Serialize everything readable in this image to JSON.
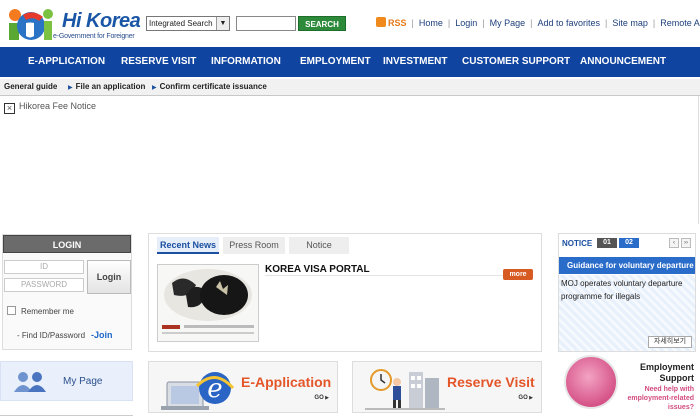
{
  "header": {
    "logo_word": "Hi Korea",
    "logo_sub": "e-Government for Foreigner",
    "search_select": "Integrated Search",
    "search_button": "SEARCH",
    "util_links": [
      "RSS",
      "Home",
      "Login",
      "My Page",
      "Add to favorites",
      "Site map",
      "Remote Assistant"
    ]
  },
  "nav": {
    "tabs": [
      "E-APPLICATION",
      "RESERVE VISIT",
      "INFORMATION",
      "EMPLOYMENT",
      "INVESTMENT",
      "CUSTOMER SUPPORT",
      "ANNOUNCEMENT"
    ]
  },
  "subnav": {
    "items": [
      "General guide",
      "File an application",
      "Confirm certificate issuance"
    ]
  },
  "fee_notice": {
    "close_glyph": "×",
    "label": "Hikorea Fee Notice"
  },
  "login": {
    "title": "LOGIN",
    "id_placeholder": "ID",
    "password_placeholder": "PASSWORD",
    "button": "Login",
    "remember": "Remember me",
    "find": "- Find ID/Password",
    "join": "-Join"
  },
  "news": {
    "tabs": [
      "Recent News",
      "Press Room",
      "Notice"
    ],
    "title": "KOREA VISA PORTAL",
    "more": "more"
  },
  "notice": {
    "label": "NOTICE",
    "pages": [
      "01",
      "02"
    ],
    "prev": "‹",
    "next": "››",
    "headline": "Guidance for voluntary departure of",
    "text": "MOJ operates voluntary departure programme for illegals",
    "detail": "자세히보기"
  },
  "mypage": {
    "label": "My Page"
  },
  "banners": {
    "eapp": {
      "title": "E-Application",
      "go": "GO"
    },
    "reserve": {
      "title": "Reserve Visit",
      "go": "GO"
    }
  },
  "support": {
    "title_line1": "Employment",
    "title_line2": "Support",
    "sub": "Need help with employment-related issues?"
  },
  "colors": {
    "nav_bg": "#0f44a0",
    "search_green": "#2c8a3a",
    "accent_orange": "#e4562a",
    "notice_blue": "#2a6cc9"
  }
}
